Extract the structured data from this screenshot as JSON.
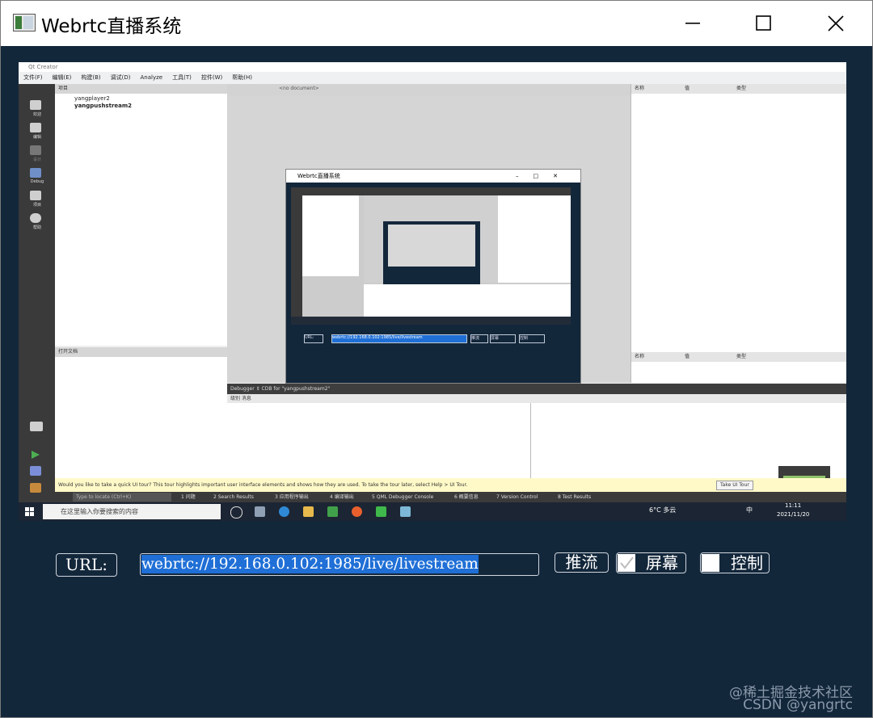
{
  "window": {
    "title": "Webrtc直播系统"
  },
  "capture": {
    "qt_title": "Qt Creator",
    "qt_menu": [
      "文件(F)",
      "编辑(E)",
      "构建(B)",
      "调试(D)",
      "Analyze",
      "工具(T)",
      "控件(W)",
      "帮助(H)"
    ],
    "project_header": "项目",
    "projects": [
      "yangplayer2",
      "yangpushstream2"
    ],
    "open_docs_header": "打开文档",
    "editor_tab": "<no document>",
    "right_cols": [
      "名称",
      "值",
      "类型"
    ],
    "right_cols2": [
      "名称",
      "值",
      "类型"
    ],
    "sidebar": [
      "欢迎",
      "编辑",
      "设计",
      "Debug",
      "项目",
      "帮助"
    ],
    "debug_bar": "Debugger  ⇕  CDB for \"yangpushstream2\"",
    "debug_cols": "级别  消息",
    "tour_text": "Would you like to take a quick UI tour? This tour highlights important user interface elements and shows how they are used. To take the tour later, select Help > UI Tour.",
    "tour_btn": "Take UI Tour",
    "locate_placeholder": "Type to locate (Ctrl+K)",
    "status_items": [
      "1 问题",
      "2 Search Results",
      "3 应用程序输出",
      "4 编译输出",
      "5 QML Debugger Console",
      "6 概要信息",
      "7 Version Control",
      "8 Test Results"
    ],
    "win_search": "在这里输入你要搜索的内容",
    "weather": "6°C 多云",
    "ime": "中",
    "time": "11:11",
    "date": "2021/11/20",
    "nested_title": "Webrtc直播系统",
    "nested_url": "URL:",
    "nested_url_value": "webrtc://192.168.0.102:1985/live/livestream",
    "nested_push": "推流",
    "nested_screen": "屏幕",
    "nested_control": "控制"
  },
  "controls": {
    "url_label": "URL:",
    "url_value": "webrtc://192.168.0.102:1985/live/livestream",
    "push_label": "推流",
    "screen_label": "屏幕",
    "screen_checked": true,
    "control_label": "控制",
    "control_checked": false
  },
  "watermark": {
    "line1": "@稀土掘金技术社区",
    "line2": "CSDN @yangrtc"
  },
  "colors": {
    "background": "#13273b",
    "selection": "#1f6fd6"
  }
}
